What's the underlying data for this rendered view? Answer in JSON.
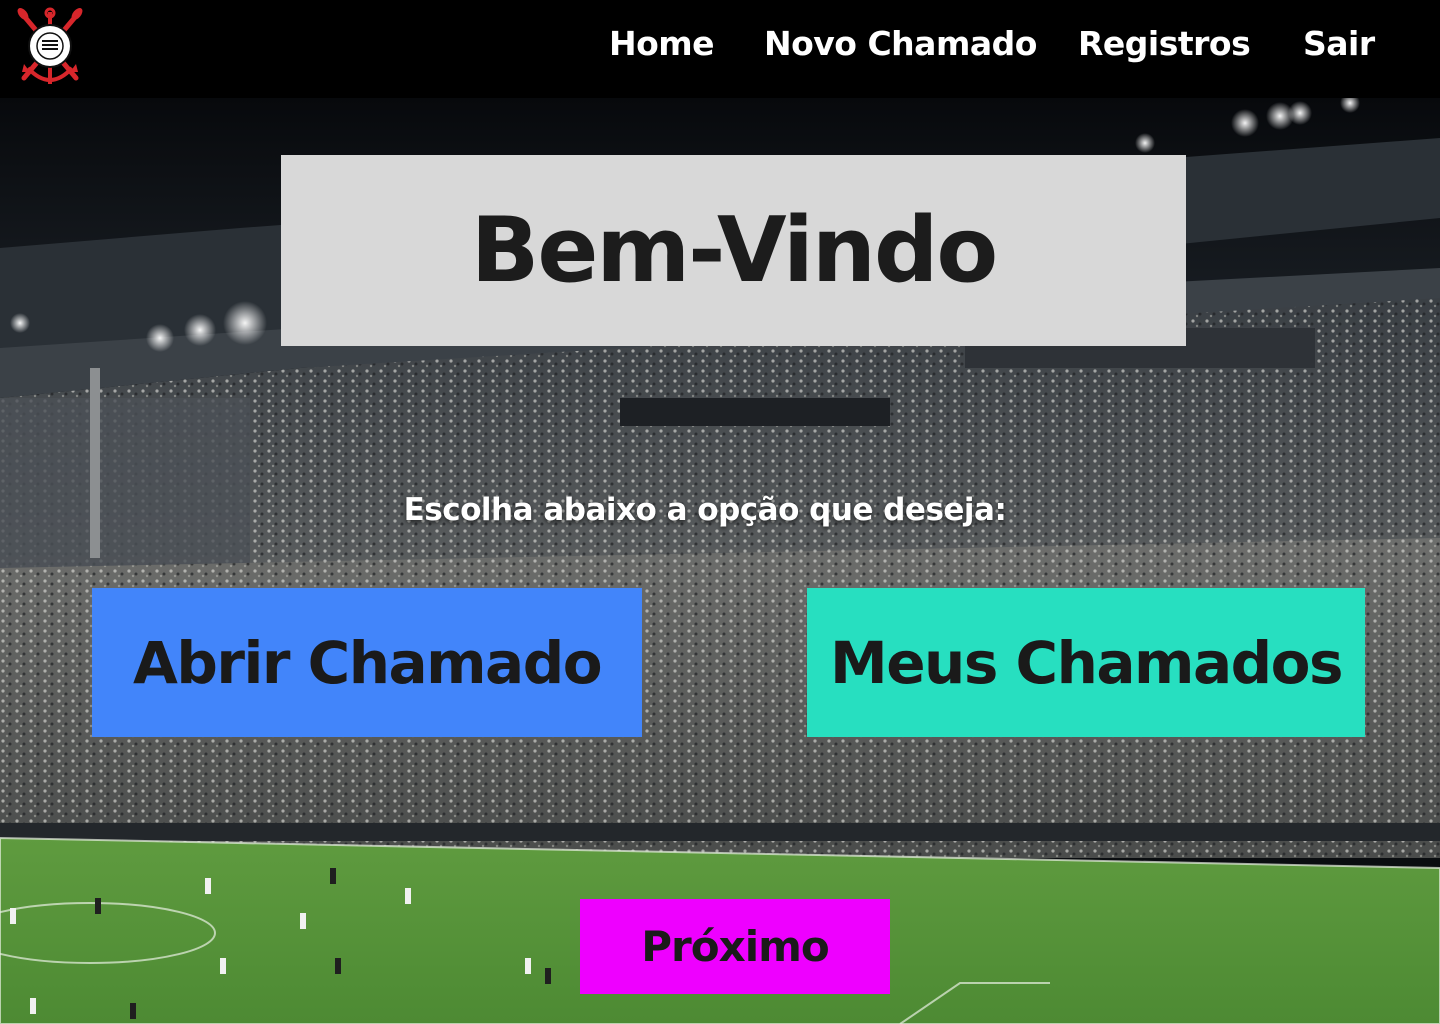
{
  "colors": {
    "topbar": "#000000",
    "welcome_box": "#d8d8d8",
    "open_ticket_button": "#4285fa",
    "my_tickets_button": "#27dfc0",
    "next_button": "#ee00ff",
    "button_text": "#1a1a1a"
  },
  "header": {
    "logo_icon": "club-crest-icon",
    "nav": {
      "home": "Home",
      "new_ticket": "Novo Chamado",
      "records": "Registros",
      "logout": "Sair"
    }
  },
  "main": {
    "background": "stadium-photo",
    "title": "Bem-Vindo",
    "prompt": "Escolha abaixo a opção que deseja:",
    "buttons": {
      "open_ticket": "Abrir Chamado",
      "my_tickets": "Meus Chamados",
      "next": "Próximo"
    }
  }
}
